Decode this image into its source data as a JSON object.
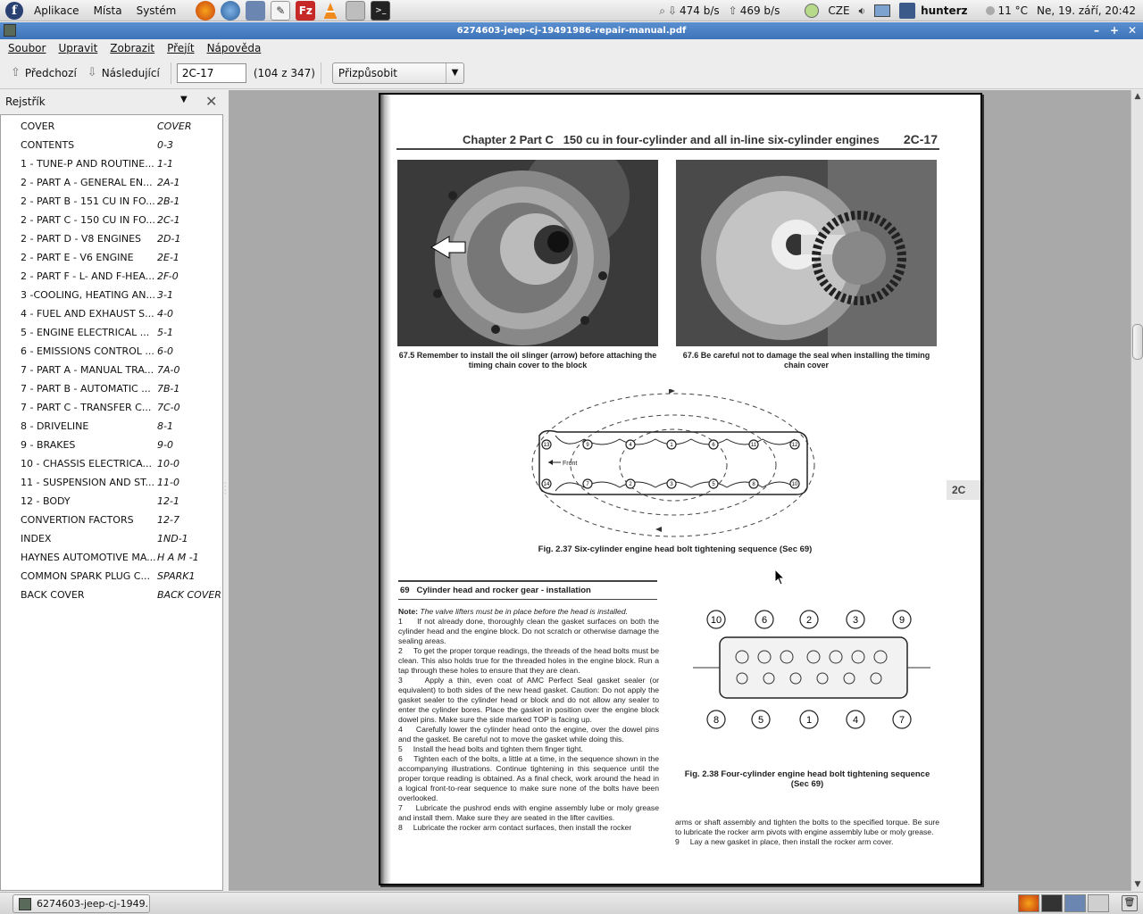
{
  "top_panel": {
    "menus": [
      "Aplikace",
      "Místa",
      "Systém"
    ],
    "net_down": "474 b/s",
    "net_up": "469 b/s",
    "keyboard": "CZE",
    "user": "hunterz",
    "weather": "11 °C",
    "clock": "Ne, 19. září, 20:42"
  },
  "window": {
    "title": "6274603-jeep-cj-19491986-repair-manual.pdf"
  },
  "menubar": [
    "Soubor",
    "Upravit",
    "Zobrazit",
    "Přejít",
    "Nápověda"
  ],
  "toolbar": {
    "prev_label": "Předchozí",
    "next_label": "Následující",
    "page_value": "2C-17",
    "page_count": "(104 z 347)",
    "zoom_value": "Přizpůsobit"
  },
  "sidebar": {
    "title": "Rejstřík",
    "items": [
      {
        "title": "COVER",
        "page": "COVER"
      },
      {
        "title": "CONTENTS",
        "page": "0-3"
      },
      {
        "title": "1 - TUNE-P AND ROUTINE...",
        "page": "1-1"
      },
      {
        "title": "2 - PART A - GENERAL EN...",
        "page": "2A-1"
      },
      {
        "title": "2 - PART B - 151 CU IN FO...",
        "page": "2B-1"
      },
      {
        "title": "2 - PART C - 150 CU IN FO...",
        "page": "2C-1"
      },
      {
        "title": "2 - PART D - V8 ENGINES",
        "page": "2D-1"
      },
      {
        "title": "2 - PART E - V6 ENGINE",
        "page": "2E-1"
      },
      {
        "title": "2 - PART F - L- AND F-HEA...",
        "page": "2F-0"
      },
      {
        "title": "3 -COOLING, HEATING AN...",
        "page": "3-1"
      },
      {
        "title": "4 - FUEL AND EXHAUST S...",
        "page": "4-0"
      },
      {
        "title": "5 - ENGINE ELECTRICAL ...",
        "page": "5-1"
      },
      {
        "title": "6 - EMISSIONS CONTROL ...",
        "page": "6-0"
      },
      {
        "title": "7 - PART A - MANUAL TRA...",
        "page": "7A-0"
      },
      {
        "title": "7 - PART B - AUTOMATIC ...",
        "page": "7B-1"
      },
      {
        "title": "7 - PART C - TRANSFER C...",
        "page": "7C-0"
      },
      {
        "title": "8 - DRIVELINE",
        "page": "8-1"
      },
      {
        "title": "9 - BRAKES",
        "page": "9-0"
      },
      {
        "title": "10 - CHASSIS ELECTRICA...",
        "page": "10-0"
      },
      {
        "title": "11 - SUSPENSION AND ST...",
        "page": "11-0"
      },
      {
        "title": "12 - BODY",
        "page": "12-1"
      },
      {
        "title": "CONVERTION FACTORS",
        "page": "12-7"
      },
      {
        "title": "INDEX",
        "page": "1ND-1"
      },
      {
        "title": "HAYNES AUTOMOTIVE MA...",
        "page": "H A M -1"
      },
      {
        "title": "COMMON SPARK PLUG C...",
        "page": "SPARK1"
      },
      {
        "title": "BACK COVER",
        "page": "BACK COVER"
      }
    ]
  },
  "pdf": {
    "chapter_title": "Chapter 2 Part C   150 cu in four-cylinder and all in-line six-cylinder engines",
    "page_number": "2C-17",
    "caption_675": "67.5  Remember to install the oil slinger (arrow) before attaching the timing chain cover to the block",
    "caption_676": "67.6  Be careful not to damage the seal when installing the timing chain cover",
    "fig_237": "Fig. 2.37  Six-cylinder engine head bolt tightening sequence (Sec 69)",
    "fig_238": "Fig. 2.38  Four-cylinder engine head bolt tightening sequence (Sec 69)",
    "front_label": "Front",
    "section_tab": "2C",
    "section_heading": "69   Cylinder head and rocker gear - installation",
    "note_label": "Note:",
    "note_text": " The valve lifters must be in place before the head is installed.",
    "steps": [
      "1     If not already done, thoroughly clean the gasket surfaces on both the cylinder head and the engine block. Do not scratch or otherwise damage the sealing areas.",
      "2     To get the proper torque readings, the threads of the head bolts must be clean. This also holds true for the threaded holes in the engine block. Run a tap through these holes to ensure that they are clean.",
      "3     Apply a thin, even coat of AMC Perfect Seal gasket sealer (or equivalent) to both sides of the new head gasket. Caution: Do not apply the gasket sealer to the cylinder head or block and do not allow any sealer to enter the cylinder bores. Place the gasket in position over the engine block dowel pins. Make sure the side marked TOP is facing up.",
      "4     Carefully lower the cylinder head onto the engine, over the dowel pins and the gasket. Be careful not to move the gasket while doing this.",
      "5     Install the head bolts and tighten them finger tight.",
      "6     Tighten each of the bolts, a little at a time, in the sequence shown in the accompanying illustrations. Continue tightening in this sequence until the proper torque reading is obtained. As a final check, work around the head in a logical front-to-rear sequence to make sure none of the bolts have been overlooked.",
      "7     Lubricate the pushrod ends with engine assembly lube or moly grease and install them. Make sure they are seated in the lifter cavities.",
      "8     Lubricate the rocker arm contact surfaces, then install the rocker"
    ],
    "continued_text": "arms or shaft assembly and tighten the bolts to the specified torque. Be sure to lubricate the rocker arm pivots with engine assembly lube or moly grease.",
    "step_9": "9     Lay a new gasket in place, then install the rocker arm cover.",
    "six_cyl_bolts_top": [
      "13",
      "9",
      "4",
      "1",
      "6",
      "11",
      "12"
    ],
    "six_cyl_bolts_bottom": [
      "14",
      "7",
      "2",
      "3",
      "5",
      "8",
      "10"
    ],
    "four_cyl_bolts_top": [
      "10",
      "6",
      "2",
      "3",
      "9"
    ],
    "four_cyl_bolts_bottom": [
      "8",
      "5",
      "1",
      "4",
      "7"
    ]
  },
  "taskbar": {
    "task_label": "6274603-jeep-cj-1949..."
  }
}
